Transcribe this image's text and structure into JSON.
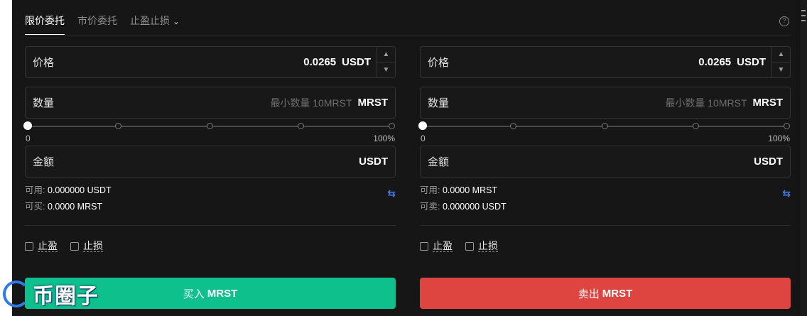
{
  "tabs": [
    {
      "label": "限价委托"
    },
    {
      "label": "市价委托"
    },
    {
      "label": "止盈止损"
    }
  ],
  "help_icon": "question-circle-icon",
  "buy": {
    "price_label": "价格",
    "price_value": "0.0265",
    "price_unit": "USDT",
    "qty_label": "数量",
    "qty_placeholder": "最小数量 10MRST",
    "qty_unit": "MRST",
    "slider_min": "0",
    "slider_max": "100%",
    "slider_value": 0,
    "amount_label": "金额",
    "amount_unit": "USDT",
    "available_label": "可用:",
    "available_value": "0.000000 USDT",
    "can_label": "可买:",
    "can_value": "0.0000 MRST",
    "tp_label": "止盈",
    "sl_label": "止损",
    "button_prefix": "买入",
    "button_asset": "MRST",
    "color": "#0ec08c"
  },
  "sell": {
    "price_label": "价格",
    "price_value": "0.0265",
    "price_unit": "USDT",
    "qty_label": "数量",
    "qty_placeholder": "最小数量 10MRST",
    "qty_unit": "MRST",
    "slider_min": "0",
    "slider_max": "100%",
    "slider_value": 0,
    "amount_label": "金额",
    "amount_unit": "USDT",
    "available_label": "可用:",
    "available_value": "0.0000 MRST",
    "can_label": "可卖:",
    "can_value": "0.000000 USDT",
    "tp_label": "止盈",
    "sl_label": "止损",
    "button_prefix": "卖出",
    "button_asset": "MRST",
    "color": "#de4540"
  },
  "watermark": {
    "text": "币圈子"
  }
}
